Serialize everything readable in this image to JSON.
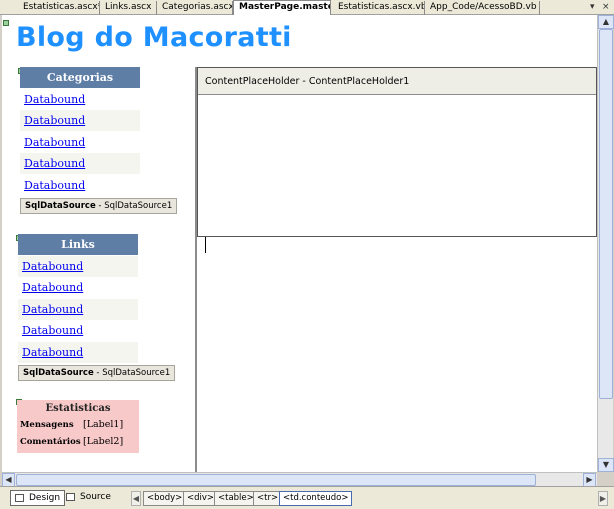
{
  "tabs": [
    {
      "label": "Estatisticas.ascx*",
      "active": false
    },
    {
      "label": "Links.ascx",
      "active": false
    },
    {
      "label": "Categorias.ascx",
      "active": false
    },
    {
      "label": "MasterPage.master",
      "active": true
    },
    {
      "label": "Estatisticas.ascx.vb",
      "active": false
    },
    {
      "label": "App_Code/AcessoBD.vb",
      "active": false
    }
  ],
  "window_controls": {
    "dropdown": "▾",
    "close": "×"
  },
  "page": {
    "title": "Blog do Macoratti",
    "categorias": {
      "header": "Categorias",
      "items": [
        "Databound",
        "Databound",
        "Databound",
        "Databound",
        "Databound"
      ],
      "datasource_type": "SqlDataSource",
      "datasource_id": " - SqlDataSource1"
    },
    "links": {
      "header": "Links",
      "items": [
        "Databound",
        "Databound",
        "Databound",
        "Databound",
        "Databound"
      ],
      "datasource_type": "SqlDataSource",
      "datasource_id": " - SqlDataSource1"
    },
    "estatisticas": {
      "header": "Estatisticas",
      "rows": [
        {
          "label": "Mensagens",
          "value": "[Label1]"
        },
        {
          "label": "Comentários",
          "value": "[Label2]"
        }
      ]
    },
    "content_placeholder": "ContentPlaceHolder - ContentPlaceHolder1"
  },
  "bottom": {
    "views": [
      {
        "label": "Design",
        "active": true
      },
      {
        "label": "Source",
        "active": false
      }
    ],
    "breadcrumb": [
      "<body>",
      "<div>",
      "<table>",
      "<tr>",
      "<td.conteudo>"
    ]
  }
}
